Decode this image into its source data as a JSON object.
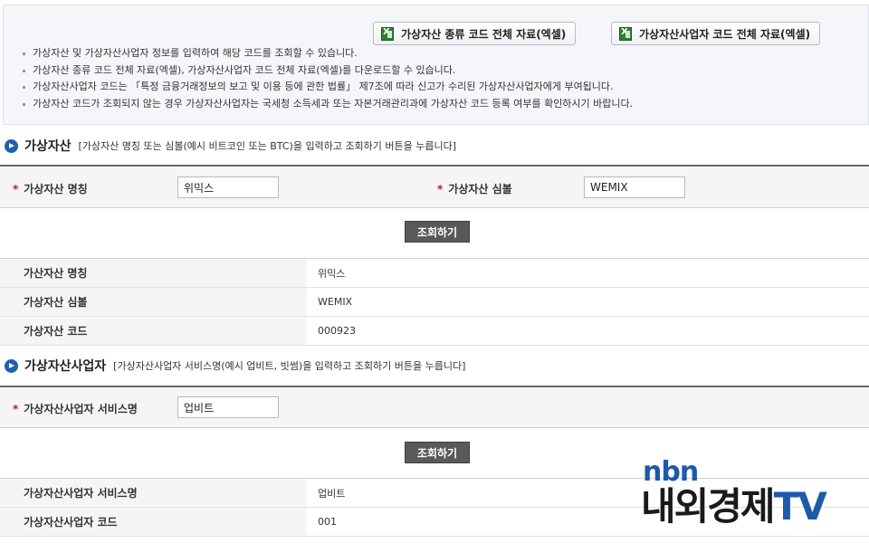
{
  "info": {
    "buttons": [
      {
        "label": "가상자산 종류 코드 전체 자료(엑셀)",
        "icon": "excel-icon"
      },
      {
        "label": "가상자산사업자 코드 전체 자료(엑셀)",
        "icon": "excel-icon"
      }
    ],
    "bullets": [
      "가상자산 및 가상자산사업자 정보를 입력하여 해당 코드를 조회할 수 있습니다.",
      "가상자산 종류 코드 전체 자료(엑셀), 가상자산사업자 코드 전체 자료(엑셀)를 다운로드할 수 있습니다.",
      "가상자산사업자 코드는 「특정 금융거래정보의 보고 및 이용 등에 관한 법률」 제7조에 따라 신고가 수리된 가상자산사업자에게 부여됩니다.",
      "가상자산 코드가 조회되지 않는 경우 가상자산사업자는 국세청 소득세과 또는 자본거래관리과에 가상자산 코드 등록 여부를 확인하시기 바랍니다."
    ]
  },
  "asset_section": {
    "title": "가상자산",
    "description": "[가상자산 명칭 또는 심볼(예시 비트코인 또는 BTC)을 입력하고 조회하기 버튼을 누릅니다]",
    "required_mark": "*",
    "name_label": "가상자산 명칭",
    "name_value": "위믹스",
    "symbol_label": "가상자산 심볼",
    "symbol_value": "WEMIX",
    "search_button": "조회하기",
    "results": [
      {
        "label": "가산자산 명칭",
        "value": "위믹스"
      },
      {
        "label": "가상자산 심볼",
        "value": "WEMIX"
      },
      {
        "label": "가상자산 코드",
        "value": "000923"
      }
    ]
  },
  "provider_section": {
    "title": "가상자산사업자",
    "description": "[가상자산사업자 서비스명(예시 업비트, 빗썸)을 입력하고 조회하기 버튼을 누릅니다]",
    "required_mark": "*",
    "service_label": "가상자산사업자 서비스명",
    "service_value": "업비트",
    "search_button": "조회하기",
    "results": [
      {
        "label": "가상자산사업자 서비스명",
        "value": "업비트"
      },
      {
        "label": "가상자산사업자 코드",
        "value": "001"
      }
    ]
  },
  "watermark": {
    "brand": "nbn",
    "name": "내외경제",
    "tv": "TV"
  },
  "colors": {
    "accent": "#1f5fae",
    "required": "#c8102e",
    "button": "#58595b"
  }
}
